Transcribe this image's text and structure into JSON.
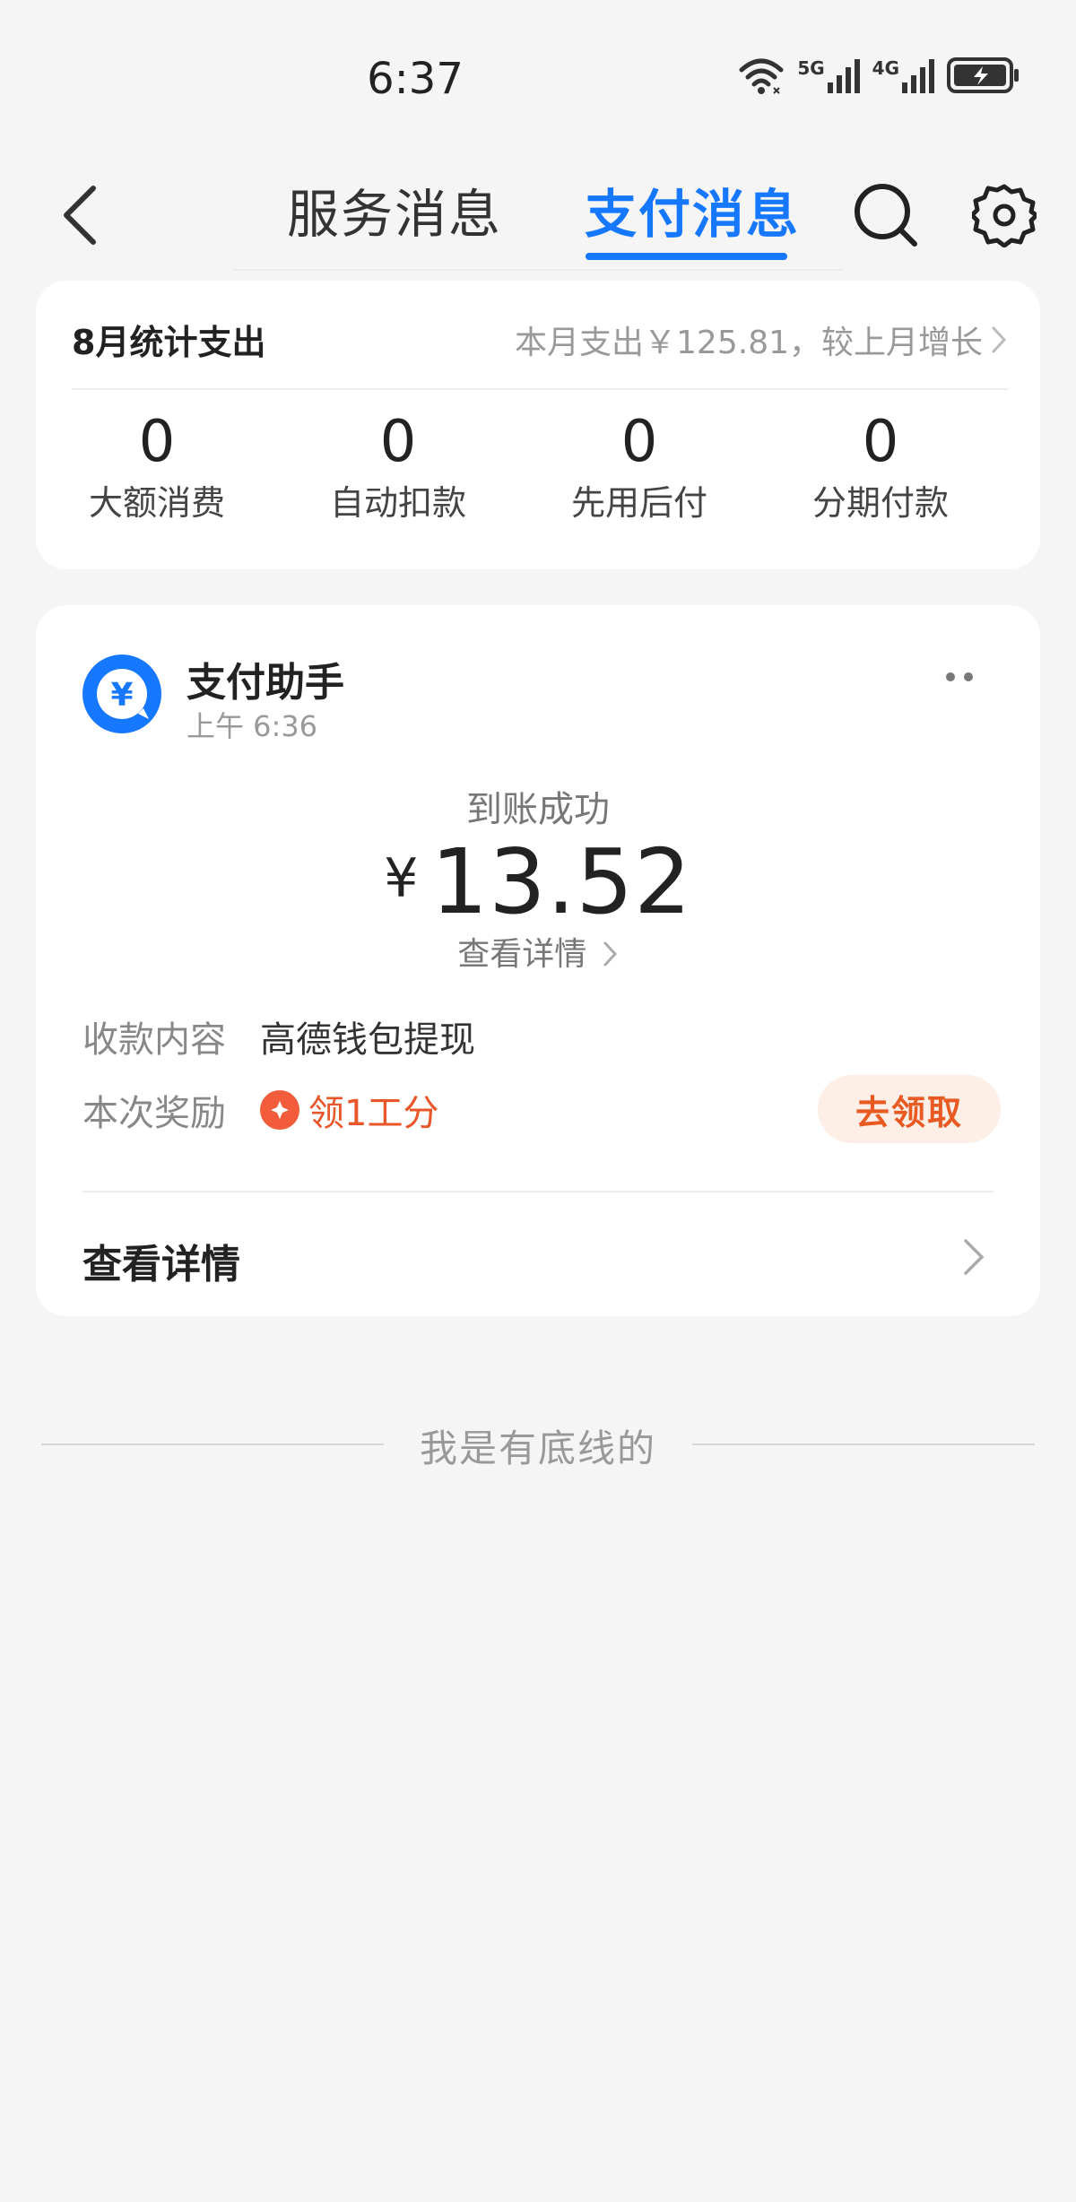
{
  "status_bar": {
    "time": "6:37",
    "net1": "5G",
    "net2": "4G"
  },
  "nav": {
    "tabs": [
      {
        "label": "服务消息",
        "active": false
      },
      {
        "label": "支付消息",
        "active": true
      }
    ],
    "icons": [
      "back-arrow-icon",
      "search-icon",
      "gear-icon"
    ]
  },
  "stats": {
    "title": "8月统计支出",
    "summary": "本月支出￥125.81，较上月增长",
    "items": [
      {
        "value": "0",
        "label": "大额消费"
      },
      {
        "value": "0",
        "label": "自动扣款"
      },
      {
        "value": "0",
        "label": "先用后付"
      },
      {
        "value": "0",
        "label": "分期付款"
      }
    ]
  },
  "message": {
    "sender": "支付助手",
    "time": "上午 6:36",
    "avatar_symbol": "¥",
    "status": "到账成功",
    "currency": "¥",
    "amount": "13.52",
    "view_detail_small": "查看详情",
    "rows": [
      {
        "label": "收款内容",
        "value": "高德钱包提现"
      },
      {
        "label": "本次奖励",
        "value": "领1工分"
      }
    ],
    "claim_button": "去领取",
    "view_detail": "查看详情"
  },
  "footer": {
    "bottom_text": "我是有底线的"
  },
  "colors": {
    "accent": "#1677ff",
    "reward": "#e8562a",
    "claim_bg": "#fdeee6",
    "background": "#f5f5f5"
  }
}
